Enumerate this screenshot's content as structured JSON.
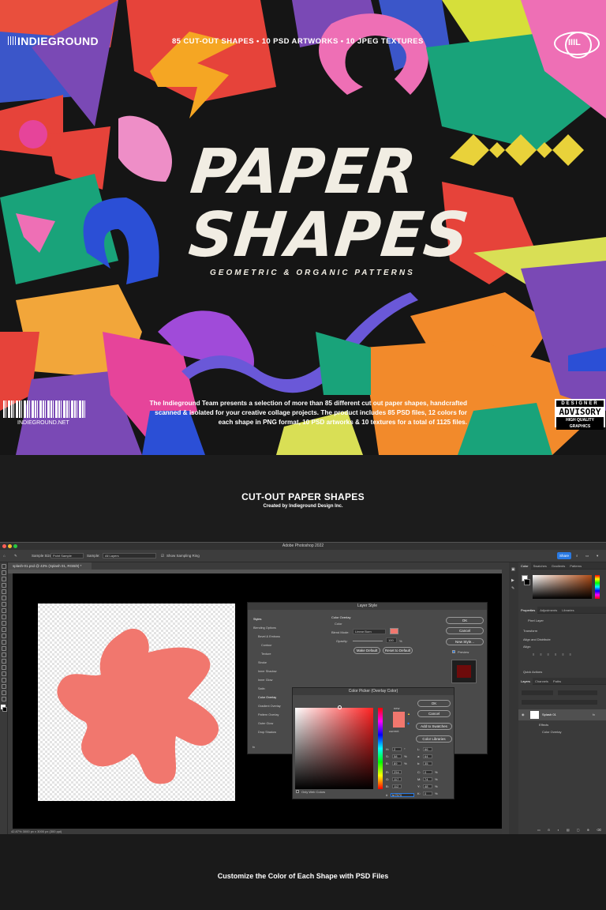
{
  "hero": {
    "brand": "INDIEGROUND",
    "tagline": "85 CUT-OUT SHAPES • 10 PSD ARTWORKS • 10 JPEG TEXTURES",
    "logo_mark": "IIIL",
    "title_line1": "PAPER",
    "title_line2": "SHAPES",
    "subtitle": "GEOMETRIC & ORGANIC PATTERNS",
    "description": "The Indieground Team presents a selection of more than 85 different cut out paper shapes, handcrafted scanned & isolated for your creative collage projects. The product includes 85 PSD files, 12 colors for each shape in PNG format, 10 PSD artworks & 10 textures for a total of 1125 files.",
    "barcode_label": "INDIEGROUND.NET",
    "advisory": {
      "line1": "DESIGNER",
      "line2": "ADVISORY",
      "line3": "HIGH QUALITY GRAPHICS"
    }
  },
  "section": {
    "heading": "CUT-OUT PAPER SHAPES",
    "subheading": "Created by Indieground Design Inc."
  },
  "photoshop": {
    "window_title": "Adobe Photoshop 2022",
    "options": {
      "sample_size_label": "Sample Size:",
      "sample_size": "Point Sample",
      "sample_label": "Sample:",
      "sample": "All Layers",
      "show_ring": "Show Sampling Ring"
    },
    "share": "Share",
    "doc_tab": "splash-01.psd @ 43% (Splash 01, RGB/8) *",
    "status": "42.87%      3000 px x 3000 px (300 ppi)",
    "right_panel": {
      "tabs": [
        "Color",
        "Swatches",
        "Gradients",
        "Patterns"
      ],
      "prop_tabs": [
        "Properties",
        "Adjustments",
        "Libraries"
      ],
      "pixel_layer": "Pixel Layer",
      "transform": "Transform",
      "align": "Align and Distribute",
      "align_sub": "Align:",
      "quick": "Quick Actions",
      "layer_tabs": [
        "Layers",
        "Channels",
        "Paths"
      ],
      "layer_name": "Splash 01",
      "effects": "Effects",
      "color_overlay": "Color Overlay"
    },
    "layer_style": {
      "title": "Layer Style",
      "styles_header": "Styles",
      "items": [
        "Blending Options",
        "Bevel & Emboss",
        "Contour",
        "Texture",
        "Stroke",
        "Inner Shadow",
        "Inner Glow",
        "Satin",
        "Color Overlay",
        "Gradient Overlay",
        "Pattern Overlay",
        "Outer Glow",
        "Drop Shadow"
      ],
      "panel_title": "Color Overlay",
      "panel_sub": "Color",
      "blend_label": "Blend Mode:",
      "blend_value": "Linear Burn",
      "opacity_label": "Opacity:",
      "opacity_value": "100",
      "pct": "%",
      "make_default": "Make Default",
      "reset_default": "Reset to Default",
      "ok": "OK",
      "cancel": "Cancel",
      "new_style": "New Style...",
      "preview": "Preview",
      "fx": "fx"
    },
    "color_picker": {
      "title": "Color Picker (Overlay Color)",
      "new": "new",
      "current": "current",
      "ok": "OK",
      "cancel": "Cancel",
      "add_swatches": "Add to Swatches",
      "color_libraries": "Color Libraries",
      "only_web": "Only Web Colors",
      "H": "2",
      "S": "58",
      "B": "89",
      "R": "254",
      "G": "117",
      "Bl": "112",
      "L": "66",
      "a": "64",
      "b": "35",
      "C": "0",
      "M": "74",
      "Y": "48",
      "K": "0",
      "hex": "fe7570",
      "overlay_color": "#f1776e"
    }
  },
  "caption": "Customize the Color of Each Shape with PSD Files"
}
